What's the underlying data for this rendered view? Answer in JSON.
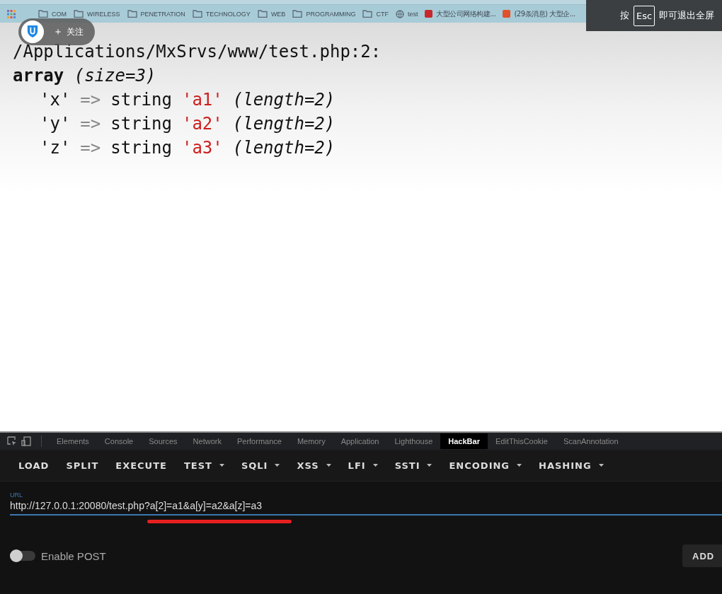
{
  "bookmarks": [
    {
      "kind": "folder",
      "label": "COM"
    },
    {
      "kind": "folder",
      "label": "WIRELESS"
    },
    {
      "kind": "folder",
      "label": "PENETRATION"
    },
    {
      "kind": "folder",
      "label": "TECHNOLOGY"
    },
    {
      "kind": "folder",
      "label": "WEB"
    },
    {
      "kind": "folder",
      "label": "PROGRAMMING"
    },
    {
      "kind": "folder",
      "label": "CTF"
    },
    {
      "kind": "globe",
      "label": "test"
    },
    {
      "kind": "logo",
      "color": "#c8282d",
      "label": "大型公司网络构建..."
    },
    {
      "kind": "logo",
      "color": "#e0522b",
      "label": "(29条消息) 大型企..."
    }
  ],
  "follow_overlay": {
    "label": "关注",
    "icon": "＋"
  },
  "fullscreen_hint": {
    "before": "按",
    "key": "Esc",
    "after": "即可退出全屏"
  },
  "dump": {
    "path": "/Applications/MxSrvs/www/test.php:2:",
    "type": "array",
    "size": "(size=3)",
    "entries": [
      {
        "key": "'x'",
        "arrow": "=>",
        "type": "string",
        "value": "'a1'",
        "length": "(length=2)"
      },
      {
        "key": "'y'",
        "arrow": "=>",
        "type": "string",
        "value": "'a2'",
        "length": "(length=2)"
      },
      {
        "key": "'z'",
        "arrow": "=>",
        "type": "string",
        "value": "'a3'",
        "length": "(length=2)"
      }
    ]
  },
  "devtools": {
    "tabs": [
      {
        "label": "Elements",
        "selected": false
      },
      {
        "label": "Console",
        "selected": false
      },
      {
        "label": "Sources",
        "selected": false
      },
      {
        "label": "Network",
        "selected": false
      },
      {
        "label": "Performance",
        "selected": false
      },
      {
        "label": "Memory",
        "selected": false
      },
      {
        "label": "Application",
        "selected": false
      },
      {
        "label": "Lighthouse",
        "selected": false
      },
      {
        "label": "HackBar",
        "selected": true
      },
      {
        "label": "EditThisCookie",
        "selected": false
      },
      {
        "label": "ScanAnnotation",
        "selected": false
      }
    ]
  },
  "hackbar": {
    "menu": [
      {
        "label": "LOAD",
        "dropdown": false
      },
      {
        "label": "SPLIT",
        "dropdown": false
      },
      {
        "label": "EXECUTE",
        "dropdown": false
      },
      {
        "label": "TEST",
        "dropdown": true
      },
      {
        "label": "SQLI",
        "dropdown": true
      },
      {
        "label": "XSS",
        "dropdown": true
      },
      {
        "label": "LFI",
        "dropdown": true
      },
      {
        "label": "SSTI",
        "dropdown": true
      },
      {
        "label": "ENCODING",
        "dropdown": true
      },
      {
        "label": "HASHING",
        "dropdown": true
      }
    ],
    "url_label": "URL",
    "url": "http://127.0.0.1:20080/test.php?a[2]=a1&a[y]=a2&a[z]=a3",
    "enable_post": {
      "label": "Enable POST",
      "on": false
    },
    "add_button": "ADD"
  }
}
